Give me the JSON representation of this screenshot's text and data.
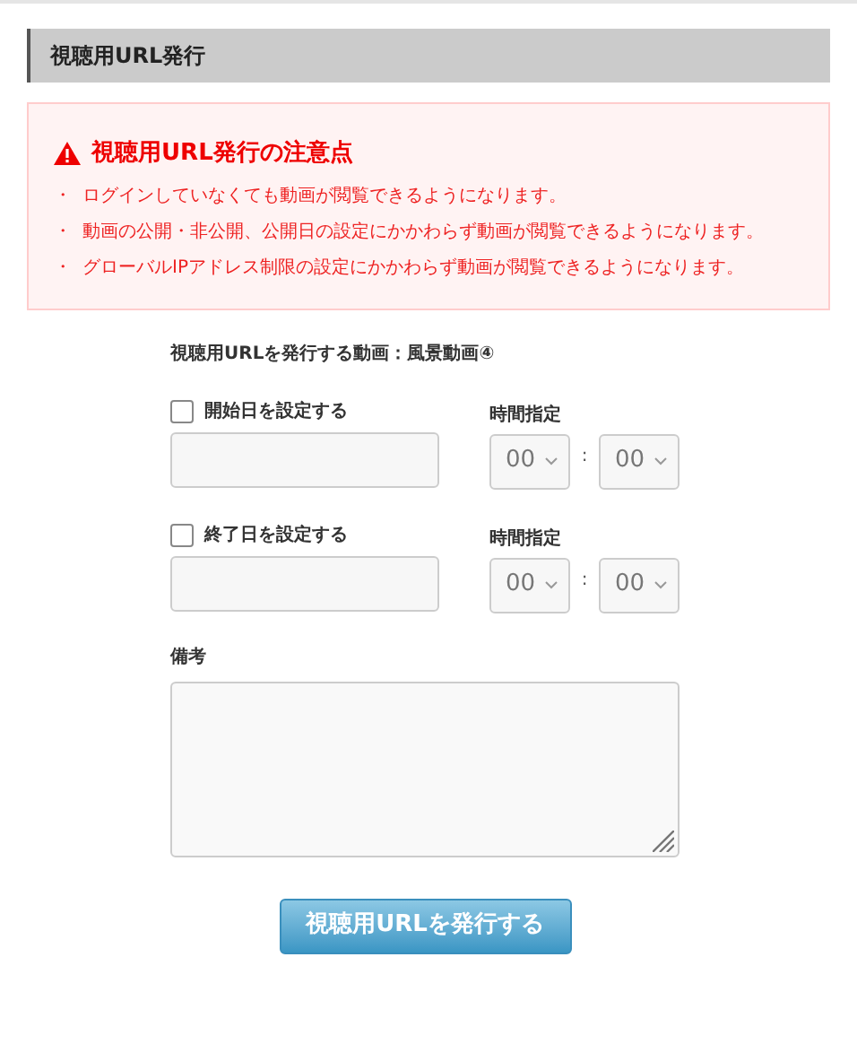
{
  "section_title": "視聴用URL発行",
  "notice": {
    "title": "視聴用URL発行の注意点",
    "items": [
      {
        "bullet": "・",
        "text": "ログインしていなくても動画が閲覧できるようになります。"
      },
      {
        "bullet": "・",
        "text": "動画の公開・非公開、公開日の設定にかかわらず動画が閲覧できるようになります。"
      },
      {
        "bullet": "・",
        "text": "グローバルIPアドレス制限の設定にかかわらず動画が閲覧できるようになります。"
      }
    ]
  },
  "target_label": "視聴用URLを発行する動画：風景動画④",
  "date_settings": [
    {
      "label": "開始日を設定する",
      "checked": false,
      "time_label": "時間指定",
      "hour": "00",
      "separator": ":",
      "minute": "00"
    },
    {
      "label": "終了日を設定する",
      "checked": false,
      "time_label": "時間指定",
      "hour": "00",
      "separator": ":",
      "minute": "00"
    }
  ],
  "notes_label": "備考",
  "submit_button": "視聴用URLを発行する"
}
